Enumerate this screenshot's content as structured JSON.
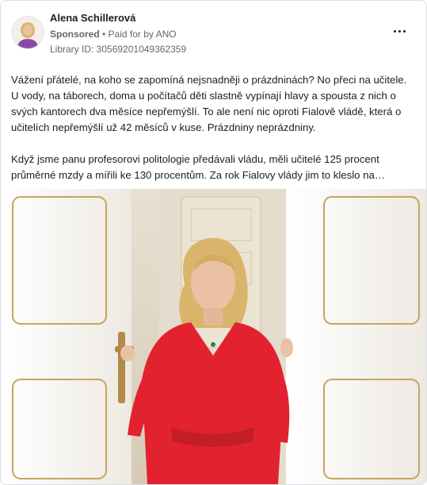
{
  "post": {
    "page_name": "Alena Schillerová",
    "sponsored_label": "Sponsored",
    "separator": " • ",
    "paid_for": "Paid for by ANO",
    "library_id": "Library ID: 30569201049362359",
    "paragraphs": [
      "Vážení přátelé, na koho se zapomíná nejsnadněji o prázdninách? No přeci na učitele. U vody, na táborech, doma u počítačů děti slastně vypínají hlavy a spousta z nich o svých kantorech dva měsíce nepřemýšlí. To ale není nic oproti Fialově vládě, která o učitelích nepřemýšlí už 42 měsíců v kuse. Prázdniny neprázdniny.",
      "Když jsme panu profesorovi politologie předávali vládu, měli učitelé 125 procent průměrné mzdy a mířili ke 130 procentům. Za rok Fialovy vlády jim to kleslo na…"
    ]
  },
  "icons": {
    "more": "more-horizontal-icon",
    "avatar": "profile-avatar"
  },
  "colors": {
    "dress": "#e3222f",
    "door": "#f7f5f1",
    "gold_trim": "#c9a45a",
    "hair": "#d9b56b"
  }
}
